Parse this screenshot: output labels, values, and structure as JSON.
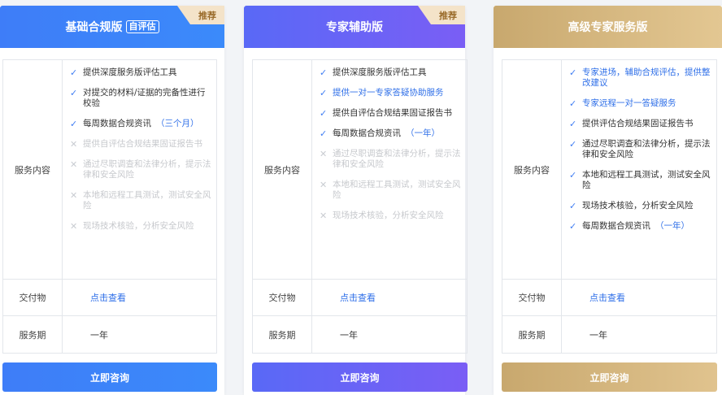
{
  "colors": {
    "basic": "#3e7df8",
    "expert": "#6a63f5",
    "premium": "#d4b47a",
    "ribbon_bg": "#f4e3c9",
    "link": "#2f6fe8"
  },
  "labels": {
    "services": "服务内容",
    "deliverables": "交付物",
    "period": "服务期"
  },
  "plans": [
    {
      "title": "基础合规版",
      "tag": "自评估",
      "ribbon": "推荐",
      "features": [
        {
          "text": "提供深度服务版评估工具",
          "icon": "check-icon"
        },
        {
          "text": "对提交的材料/证据的完备性进行校验",
          "icon": "check-icon"
        },
        {
          "text": "每周数据合规资讯",
          "note": "（三个月）",
          "icon": "check-icon"
        },
        {
          "text": "提供自评估合规结果固证报告书",
          "icon": "cross-icon"
        },
        {
          "text": "通过尽职调查和法律分析，提示法律和安全风险",
          "icon": "cross-icon"
        },
        {
          "text": "本地和远程工具测试，测试安全风险",
          "icon": "cross-icon"
        },
        {
          "text": "现场技术核验，分析安全风险",
          "icon": "cross-icon"
        }
      ],
      "deliverable": "点击查看",
      "period": "一年",
      "cta": "立即咨询"
    },
    {
      "title": "专家辅助版",
      "ribbon": "推荐",
      "features": [
        {
          "text": "提供深度服务版评估工具",
          "icon": "check-icon"
        },
        {
          "text": "提供一对一专家答疑协助服务",
          "icon": "check-icon"
        },
        {
          "text": "提供自评估合规结果固证报告书",
          "icon": "check-icon"
        },
        {
          "text": "每周数据合规资讯",
          "note": "（一年）",
          "icon": "check-icon"
        },
        {
          "text": "通过尽职调查和法律分析，提示法律和安全风险",
          "icon": "cross-icon"
        },
        {
          "text": "本地和远程工具测试，测试安全风险",
          "icon": "cross-icon"
        },
        {
          "text": "现场技术核验，分析安全风险",
          "icon": "cross-icon"
        }
      ],
      "deliverable": "点击查看",
      "period": "一年",
      "cta": "立即咨询"
    },
    {
      "title": "高级专家服务版",
      "features": [
        {
          "text": "专家进场，辅助合规评估，提供整改建议",
          "icon": "check-icon"
        },
        {
          "text": "专家远程一对一答疑服务",
          "icon": "check-icon"
        },
        {
          "text": "提供评估合规结果固证报告书",
          "icon": "check-icon"
        },
        {
          "text": "通过尽职调查和法律分析，提示法律和安全风险",
          "icon": "check-icon"
        },
        {
          "text": "本地和远程工具测试，测试安全风险",
          "icon": "check-icon"
        },
        {
          "text": "现场技术核验，分析安全风险",
          "icon": "check-icon"
        },
        {
          "text": "每周数据合规资讯",
          "note": "（一年）",
          "icon": "check-icon"
        }
      ],
      "deliverable": "点击查看",
      "period": "一年",
      "cta": "立即咨询"
    }
  ]
}
